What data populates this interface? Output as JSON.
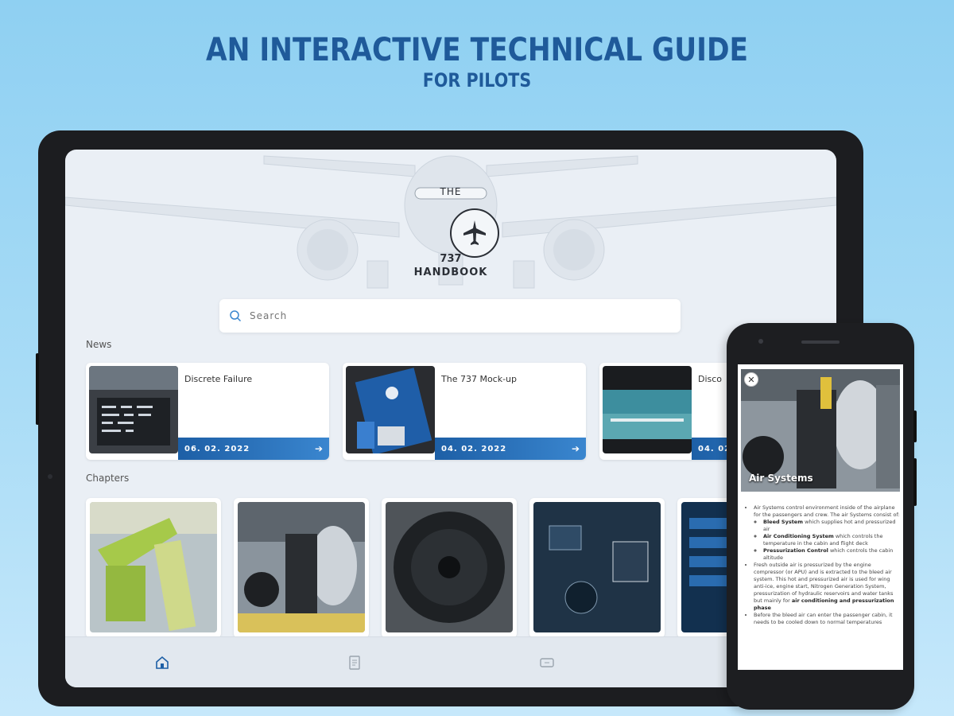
{
  "headline": {
    "title": "AN INTERACTIVE TECHNICAL GUIDE",
    "subtitle": "FOR PILOTS"
  },
  "app": {
    "logo_the": "THE",
    "logo_737": "737",
    "logo_handbook": "HANDBOOK",
    "search_placeholder": "Search"
  },
  "sections": {
    "news": "News",
    "chapters": "Chapters"
  },
  "news": [
    {
      "title": "Discrete Failure",
      "date": "06. 02. 2022"
    },
    {
      "title": "The 737 Mock-up",
      "date": "04. 02. 2022"
    },
    {
      "title": "Disco",
      "date": "04. 02."
    }
  ],
  "nav": [
    "home-icon",
    "document-icon",
    "ticket-icon"
  ],
  "phone": {
    "title": "Air Systems",
    "p1": "Air Systems control environment inside of the airplane for the passengers and crew. The air Systems consist of:",
    "items": [
      {
        "bold": "Bleed System",
        "text": " which supplies hot and pressurized air"
      },
      {
        "bold": "Air Conditioning System",
        "text": " which controls the temperature in the cabin and flight deck"
      },
      {
        "bold": "Pressurization Control",
        "text": " which controls the cabin altitude"
      }
    ],
    "p2a": "Fresh outside air is pressurized by the engine compressor (or APU) and is extracted to the bleed air system. This hot and pressurized air is used for wing anti-ice, engine start, Nitrogen Generation System, pressurization of hydraulic reservoirs and water tanks but mainly for ",
    "p2b": "air conditioning and pressurization phase",
    "p3": "Before the bleed air can enter the passenger cabin, it needs to be cooled down to normal temperatures"
  },
  "colors": {
    "accent": "#1d5fa6",
    "headline": "#1f5a9a",
    "background": "#a9dcf6"
  }
}
